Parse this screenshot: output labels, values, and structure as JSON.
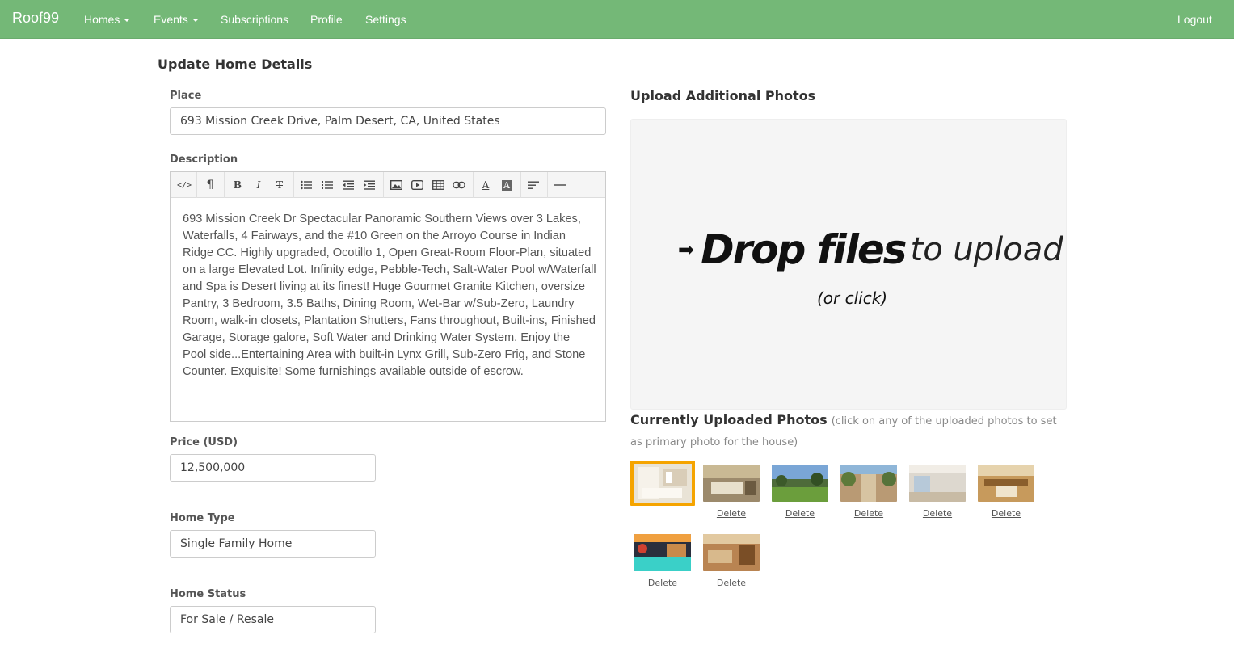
{
  "navbar": {
    "brand": "Roof99",
    "items": [
      {
        "label": "Homes",
        "dropdown": true
      },
      {
        "label": "Events",
        "dropdown": true
      },
      {
        "label": "Subscriptions",
        "dropdown": false
      },
      {
        "label": "Profile",
        "dropdown": false
      },
      {
        "label": "Settings",
        "dropdown": false
      }
    ],
    "logout": "Logout",
    "color": "#74b877"
  },
  "form": {
    "title": "Update Home Details",
    "place_label": "Place",
    "place_value": "693 Mission Creek Drive, Palm Desert, CA, United States",
    "description_label": "Description",
    "description_text": "693 Mission Creek Dr Spectacular Panoramic Southern Views over 3 Lakes, Waterfalls, 4 Fairways, and the #10 Green on the Arroyo Course in Indian Ridge CC. Highly upgraded, Ocotillo 1, Open Great-Room Floor-Plan, situated on a large Elevated Lot. Infinity edge, Pebble-Tech, Salt-Water Pool w/Waterfall and Spa is Desert living at its finest! Huge Gourmet Granite Kitchen, oversize Pantry, 3 Bedroom, 3.5 Baths, Dining Room, Wet-Bar w/Sub-Zero, Laundry Room, walk-in closets, Plantation Shutters, Fans throughout, Built-ins, Finished Garage, Storage galore, Soft Water and Drinking Water System. Enjoy the Pool side...Entertaining Area with built-in Lynx Grill, Sub-Zero Frig, and Stone Counter. Exquisite! Some furnishings available outside of escrow.",
    "price_label": "Price (USD)",
    "price_value": "12,500,000",
    "home_type_label": "Home Type",
    "home_type_value": "Single Family Home",
    "home_status_label": "Home Status",
    "home_status_value": "For Sale / Resale"
  },
  "toolbar": {
    "buttons": [
      "code-view",
      "paragraph-style",
      "bold",
      "italic",
      "strikethrough",
      "unordered-list",
      "ordered-list",
      "outdent",
      "indent",
      "insert-image",
      "insert-video",
      "insert-table",
      "insert-link",
      "font-color",
      "highlight-color",
      "align",
      "horizontal-rule"
    ]
  },
  "upload": {
    "title": "Upload Additional Photos",
    "drop_bold": "Drop files",
    "drop_light": "to upload",
    "drop_sub": "(or click)"
  },
  "photos": {
    "heading": "Currently Uploaded Photos",
    "note": "(click on any of the uploaded photos to set as primary photo for the house)",
    "delete_label": "Delete",
    "primary_color": "#f5a400"
  }
}
